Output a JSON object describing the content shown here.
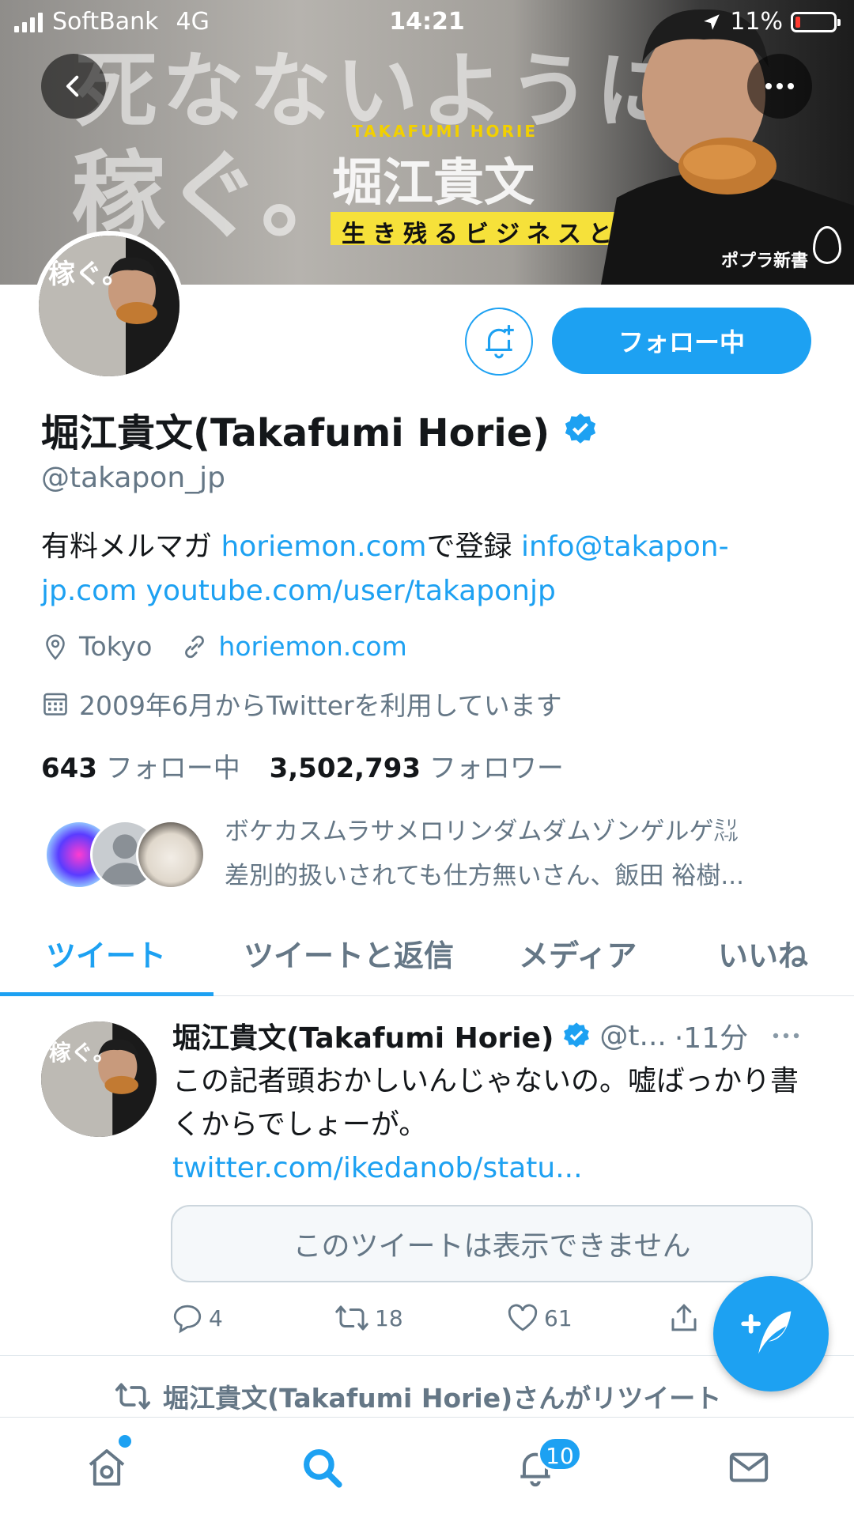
{
  "status_bar": {
    "carrier": "SoftBank",
    "network": "4G",
    "time": "14:21",
    "battery": "11%"
  },
  "banner": {
    "line1": "死なないように",
    "line2": "稼ぐ。",
    "author_en": "TAKAFUMI HORIE",
    "author_jp": "堀江貴文",
    "subtitle": "生き残るビジネスと人材",
    "publisher": "ポプラ新書"
  },
  "profile": {
    "name": "堀江貴文(Takafumi Horie)",
    "handle": "@takapon_jp",
    "follow_button": "フォロー中",
    "bio": {
      "t1": "有料メルマガ ",
      "link1": "horiemon.com",
      "t2": "で登録 ",
      "link2": "info@takapon-jp.com",
      "t3": " ",
      "link3": "youtube.com/user/takaponjp"
    },
    "location": "Tokyo",
    "website": "horiemon.com",
    "joined": "2009年6月からTwitterを利用しています",
    "following_count": "643",
    "following_label": "フォロー中",
    "followers_count": "3,502,793",
    "followers_label": "フォロワー",
    "followed_by_line1": "ボケカスムラサメロリンダムダムゾンゲルゲ㍊",
    "followed_by_line2": "差別的扱いされても仕方無いさん、飯田 裕樹..."
  },
  "tabs": [
    "ツイート",
    "ツイートと返信",
    "メディア",
    "いいね"
  ],
  "tweet": {
    "name": "堀江貴文(Takafumi Horie)",
    "handle": "@t...",
    "time": "·11分",
    "text": "この記者頭おかしいんじゃないの。嘘ばっかり書くからでしょーが。 ",
    "link": "twitter.com/ikedanob/statu...",
    "quote_unavailable": "このツイートは表示できません",
    "replies": "4",
    "retweets": "18",
    "likes": "61"
  },
  "retweet_notice": "堀江貴文(Takafumi Horie)さんがリツイート",
  "bottom_nav": {
    "notifications_badge": "10"
  },
  "colors": {
    "accent": "#1da1f2",
    "text": "#14171a",
    "secondary": "#657786"
  }
}
